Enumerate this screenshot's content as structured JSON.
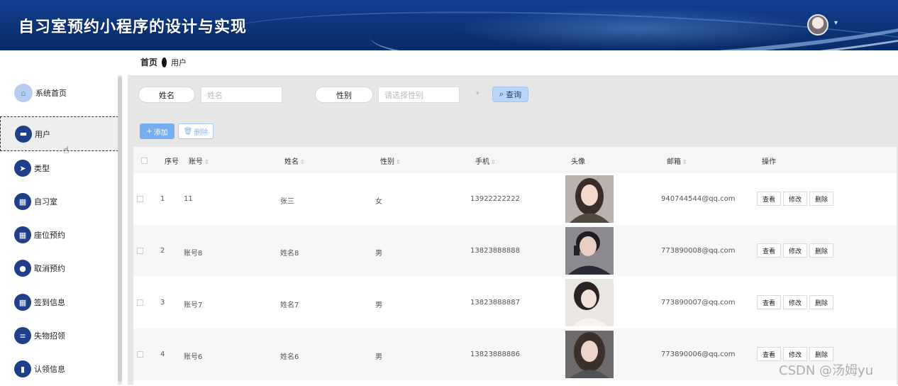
{
  "app": {
    "title": "自习室预约小程序的设计与实现"
  },
  "breadcrumb": {
    "home": "首页",
    "current": "用户"
  },
  "sidebar": {
    "items": [
      {
        "label": "系统首页",
        "icon": "house-icon"
      },
      {
        "label": "用户",
        "icon": "briefcase-icon"
      },
      {
        "label": "类型",
        "icon": "paper-plane-icon"
      },
      {
        "label": "自习室",
        "icon": "grid-icon"
      },
      {
        "label": "座位预约",
        "icon": "grid-icon"
      },
      {
        "label": "取消预约",
        "icon": "user-icon"
      },
      {
        "label": "签到信息",
        "icon": "grid-icon"
      },
      {
        "label": "失物招领",
        "icon": "list-icon"
      },
      {
        "label": "认领信息",
        "icon": "book-icon"
      }
    ],
    "active_index": 1
  },
  "search": {
    "name_label": "姓名",
    "name_placeholder": "姓名",
    "gender_label": "性别",
    "gender_placeholder": "请选择性别",
    "query_label": "查询"
  },
  "toolbar": {
    "add_label": "添加",
    "delete_label": "删除"
  },
  "table": {
    "columns": [
      "序号",
      "账号",
      "姓名",
      "性别",
      "手机",
      "头像",
      "邮箱",
      "操作"
    ],
    "rows": [
      {
        "index": "1",
        "account": "11",
        "name": "张三",
        "gender": "女",
        "phone": "13922222222",
        "email": "940744544@qq.com"
      },
      {
        "index": "2",
        "account": "账号8",
        "name": "姓名8",
        "gender": "男",
        "phone": "13823888888",
        "email": "773890008@qq.com"
      },
      {
        "index": "3",
        "account": "账号7",
        "name": "姓名7",
        "gender": "男",
        "phone": "13823888887",
        "email": "773890007@qq.com"
      },
      {
        "index": "4",
        "account": "账号6",
        "name": "姓名6",
        "gender": "男",
        "phone": "13823888886",
        "email": "773890006@qq.com"
      }
    ],
    "actions": {
      "view": "查看",
      "edit": "修改",
      "delete": "删除"
    }
  },
  "watermark": "CSDN @汤姆yu",
  "colors": {
    "header": "#0d3479",
    "accent": "#76aef2",
    "nav_icon": "#1f3f8a"
  }
}
